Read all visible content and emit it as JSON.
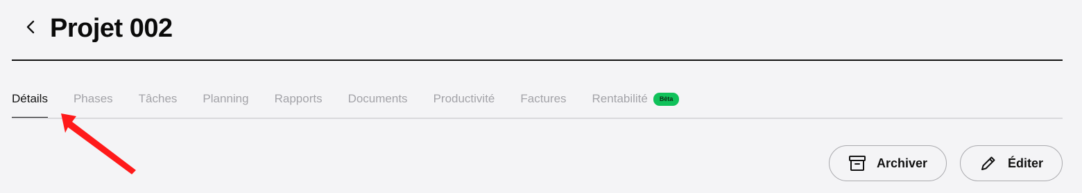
{
  "header": {
    "back_icon": "chevron-left-icon",
    "title": "Projet 002"
  },
  "tabs": [
    {
      "label": "Détails",
      "active": true
    },
    {
      "label": "Phases",
      "active": false
    },
    {
      "label": "Tâches",
      "active": false
    },
    {
      "label": "Planning",
      "active": false
    },
    {
      "label": "Rapports",
      "active": false
    },
    {
      "label": "Documents",
      "active": false
    },
    {
      "label": "Productivité",
      "active": false
    },
    {
      "label": "Factures",
      "active": false
    },
    {
      "label": "Rentabilité",
      "active": false,
      "badge": "Bêta"
    }
  ],
  "actions": {
    "archive_label": "Archiver",
    "archive_icon": "archive-box-icon",
    "edit_label": "Éditer",
    "edit_icon": "pencil-icon"
  },
  "annotation": {
    "arrow_icon": "red-arrow-pointer-icon",
    "arrow_color": "#ff1a1a"
  },
  "colors": {
    "background": "#f4f4f6",
    "active_tab": "#111111",
    "inactive_tab": "#a3a3a8",
    "badge": "#10c15a"
  }
}
